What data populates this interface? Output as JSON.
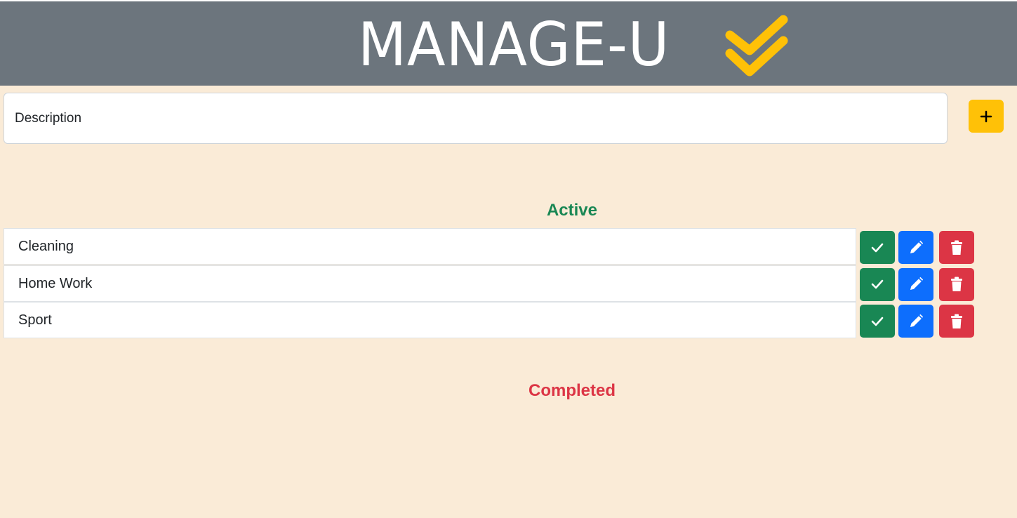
{
  "header": {
    "title": "MANAGE-U",
    "logo_icon": "double-check-icon",
    "background": "#6c757d",
    "logo_color": "#ffc107"
  },
  "new_task": {
    "placeholder": "Description",
    "value": "",
    "add_icon": "plus-icon"
  },
  "sections": {
    "active_title": "Active",
    "completed_title": "Completed"
  },
  "active_tasks": [
    {
      "label": "Cleaning"
    },
    {
      "label": "Home Work"
    },
    {
      "label": "Sport"
    }
  ],
  "completed_tasks": [],
  "actions": {
    "complete_icon": "check-icon",
    "edit_icon": "pencil-icon",
    "delete_icon": "trash-icon"
  },
  "colors": {
    "page_background": "#faebd7",
    "active": "#198754",
    "completed": "#dc3545",
    "edit": "#0d6efd",
    "add": "#ffc107"
  }
}
